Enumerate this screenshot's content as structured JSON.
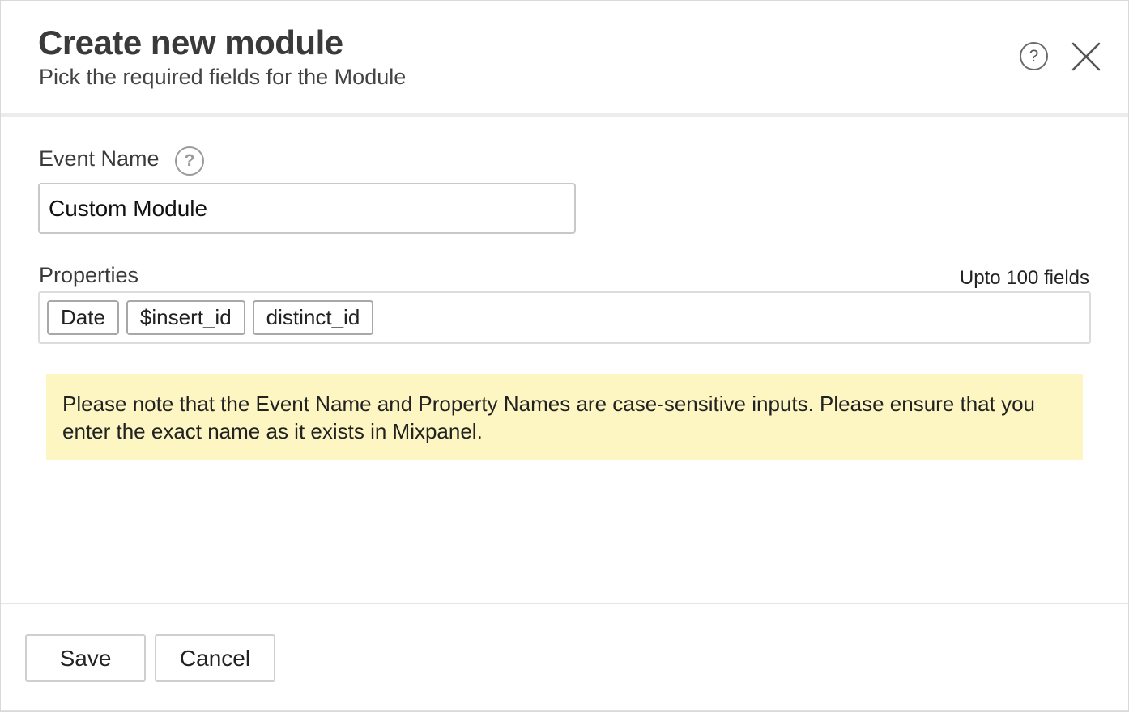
{
  "dialog": {
    "title": "Create new module",
    "subtitle": "Pick the required fields for the Module",
    "help_icon": "question-circle-icon",
    "close_icon": "close-x-icon"
  },
  "event_name": {
    "label": "Event Name",
    "help_glyph": "?",
    "value": "Custom Module"
  },
  "properties": {
    "label": "Properties",
    "limit_text": "Upto 100 fields",
    "tags": [
      "Date",
      "$insert_id",
      "distinct_id"
    ]
  },
  "note": {
    "text": "Please note that the Event Name and Property Names are case-sensitive inputs. Please ensure that you enter the exact name as it exists in Mixpanel.",
    "background": "#fdf6c3"
  },
  "footer": {
    "save_label": "Save",
    "cancel_label": "Cancel"
  }
}
